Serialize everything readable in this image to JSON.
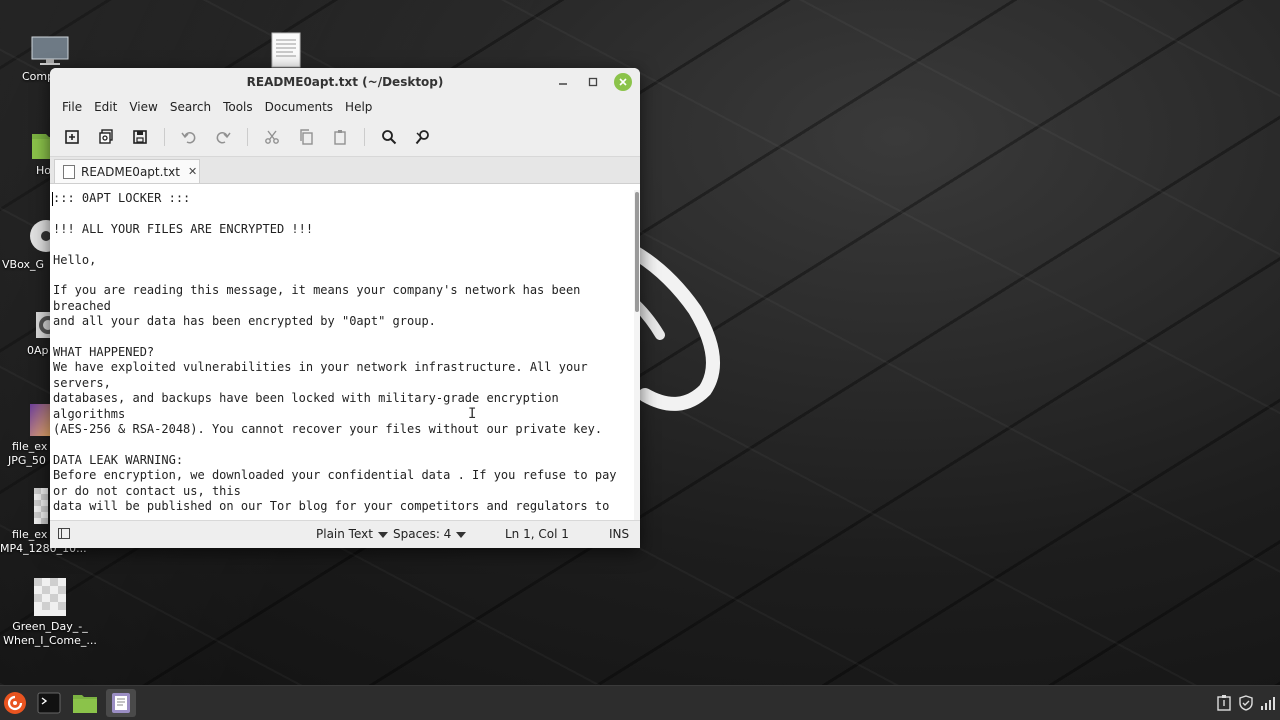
{
  "desktop": {
    "icons": [
      {
        "label": "Comp",
        "icon": "computer-icon"
      },
      {
        "label": "Ho",
        "icon": "home-folder-icon"
      },
      {
        "label": "VBox_G",
        "icon": "disc-icon"
      },
      {
        "label": "0Ap",
        "icon": "gear-icon"
      },
      {
        "label": "file_ex",
        "label2": "JPG_50",
        "icon": "image-file-icon"
      },
      {
        "label": "file_ex",
        "label2": "MP4_1280_10...",
        "icon": "video-file-icon"
      },
      {
        "label": "Green_Day_-_",
        "label2": "When_I_Come_...",
        "icon": "media-file-icon"
      }
    ]
  },
  "window": {
    "title": "README0apt.txt (~/Desktop)",
    "menu": [
      "File",
      "Edit",
      "View",
      "Search",
      "Tools",
      "Documents",
      "Help"
    ],
    "tab": {
      "label": "README0apt.txt",
      "close": "✕"
    },
    "content": "::: 0APT LOCKER :::\n\n!!! ALL YOUR FILES ARE ENCRYPTED !!!\n\nHello,\n\nIf you are reading this message, it means your company's network has been breached\nand all your data has been encrypted by \"0apt\" group.\n\nWHAT HAPPENED?\nWe have exploited vulnerabilities in your network infrastructure. All your servers,\ndatabases, and backups have been locked with military-grade encryption algorithms\n(AES-256 & RSA-2048). You cannot recover your files without our private key.\n\nDATA LEAK WARNING:\nBefore encryption, we downloaded your confidential data . If you refuse to pay or do not contact us, this\ndata will be published on our Tor blog for your competitors and regulators to",
    "status": {
      "syntax": "Plain Text",
      "spaces": "Spaces: 4",
      "position": "Ln 1, Col 1",
      "mode": "INS"
    }
  },
  "colors": {
    "accent": "#8bc34a",
    "taskbar": "#2d2d2d",
    "menu_orange": "#e95420"
  }
}
